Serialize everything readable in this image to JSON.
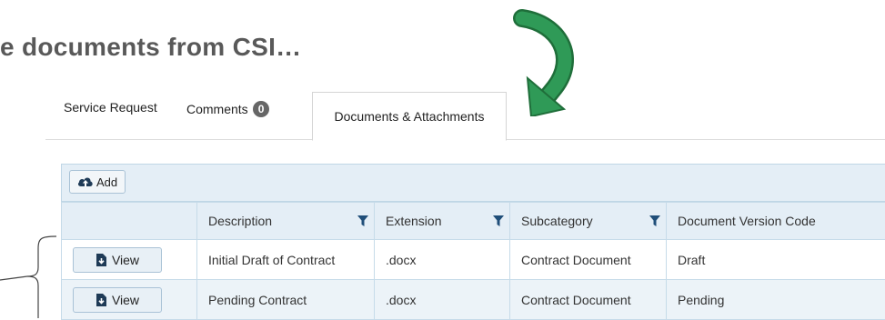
{
  "headline": "e documents from CSI…",
  "tabs": [
    {
      "label": "Service Request"
    },
    {
      "label": "Comments",
      "count": "0"
    },
    {
      "label": "Documents & Attachments"
    }
  ],
  "toolbar": {
    "add_label": "Add"
  },
  "grid": {
    "columns": [
      "Description",
      "Extension",
      "Subcategory",
      "Document Version Code"
    ],
    "rows": [
      {
        "action": "View",
        "description": "Initial Draft of Contract",
        "extension": ".docx",
        "subcategory": "Contract Document",
        "version": "Draft"
      },
      {
        "action": "View",
        "description": "Pending Contract",
        "extension": ".docx",
        "subcategory": "Contract Document",
        "version": "Pending"
      }
    ]
  },
  "colors": {
    "arrow": "#2f9a57",
    "header_bg": "#e4eef6",
    "badge": "#666666",
    "filter_icon": "#1f4e79"
  }
}
